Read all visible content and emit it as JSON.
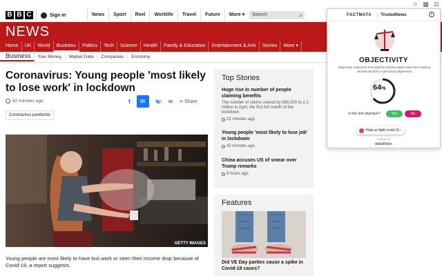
{
  "bbc": {
    "logo_letters": [
      "B",
      "B",
      "C"
    ],
    "signin": "Sign in",
    "nav": [
      "News",
      "Sport",
      "Reel",
      "Worklife",
      "Travel",
      "Future",
      "More"
    ],
    "search_placeholder": "Search"
  },
  "section": {
    "title": "NEWS",
    "nav": [
      "Home",
      "UK",
      "World",
      "Business",
      "Politics",
      "Tech",
      "Science",
      "Health",
      "Family & Education",
      "Entertainment & Arts",
      "Stories",
      "More"
    ],
    "active": "Business"
  },
  "subnav": {
    "current": "Business",
    "items": [
      "Your Money",
      "Market Data",
      "Companies",
      "Economy"
    ]
  },
  "article": {
    "headline": "Coronavirus: Young people 'most likely to lose work' in lockdown",
    "time": "42 minutes ago",
    "share_label": "Share",
    "tag": "Coronavirus pandemic",
    "image_credit": "GETTY IMAGES",
    "caption": "Young people are most likely to have lost work or seen their income drop because of Covid-19, a report suggests."
  },
  "top_stories": {
    "title": "Top Stories",
    "items": [
      {
        "headline": "Huge rise in number of people claiming benefits",
        "summary": "The number of claims soared by 856,500 to 2.1 million in April, the first full month of the lockdown",
        "time": "22 minutes ago"
      },
      {
        "headline": "Young people 'most likely to lose job' in lockdown",
        "summary": "",
        "time": "42 minutes ago"
      },
      {
        "headline": "China accuses US of smear over Trump remarks",
        "summary": "",
        "time": "9 hours ago"
      }
    ]
  },
  "features": {
    "title": "Features",
    "caption": "Did VE Day parties cause a spike in Covid-19 cases?"
  },
  "extension": {
    "brand1": "FACTMATA",
    "brand2": "TrustedNews",
    "title": "OBJECTIVITY",
    "description": "Objectivity measures how well the articles states clear facts without introducing bias or personal judgements",
    "score": "64",
    "score_unit": "%",
    "score_value": 64,
    "question": "Is this text objective?",
    "yes_label": "Yes",
    "no_label": "No",
    "help_label": "Help us fight covid-19 ›",
    "powered_by": "Powered by",
    "partner": "dataRhino",
    "accent_yes": "#3fbf5c",
    "accent_no": "#d6176e"
  },
  "colors": {
    "brand_red": "#bb1919"
  }
}
